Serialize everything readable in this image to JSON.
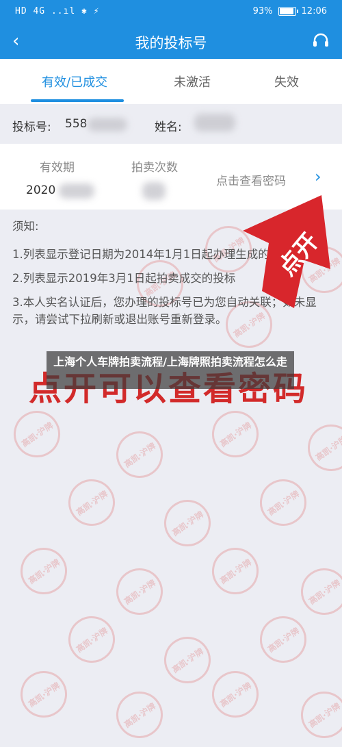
{
  "status": {
    "left_icons": "HD 4G ..ıl ✱ ⚡",
    "battery": "93%",
    "battery_level": 0.93,
    "time": "12:06"
  },
  "nav": {
    "title": "我的投标号"
  },
  "tabs": [
    {
      "label": "有效/已成交",
      "active": true
    },
    {
      "label": "未激活",
      "active": false
    },
    {
      "label": "失效",
      "active": false
    }
  ],
  "info": {
    "bid_label": "投标号:",
    "bid_value": "558",
    "name_label": "姓名:"
  },
  "card": {
    "validity_header": "有效期",
    "auction_count_header": "拍卖次数",
    "validity_value": "2020",
    "view_password": "点击查看密码"
  },
  "notes": {
    "title": "须知:",
    "items": [
      "1.列表显示登记日期为2014年1月1日起办理生成的有效投标号;",
      "2.列表显示2019年3月1日起拍卖成交的投标",
      "3.本人实名认证后，您办理的投标号已为您自动关联；如未显示，请尝试下拉刷新或退出账号重新登录。"
    ]
  },
  "annotations": {
    "arrow_text": "点开",
    "big_text": "点开可以查看密码"
  },
  "overlay": {
    "caption": "上海个人车牌拍卖流程/上海牌照拍卖流程怎么走"
  },
  "watermark": {
    "text": "高凯·沪牌"
  },
  "colors": {
    "primary": "#1f8fe0",
    "annotation_red": "#d22a2a"
  }
}
